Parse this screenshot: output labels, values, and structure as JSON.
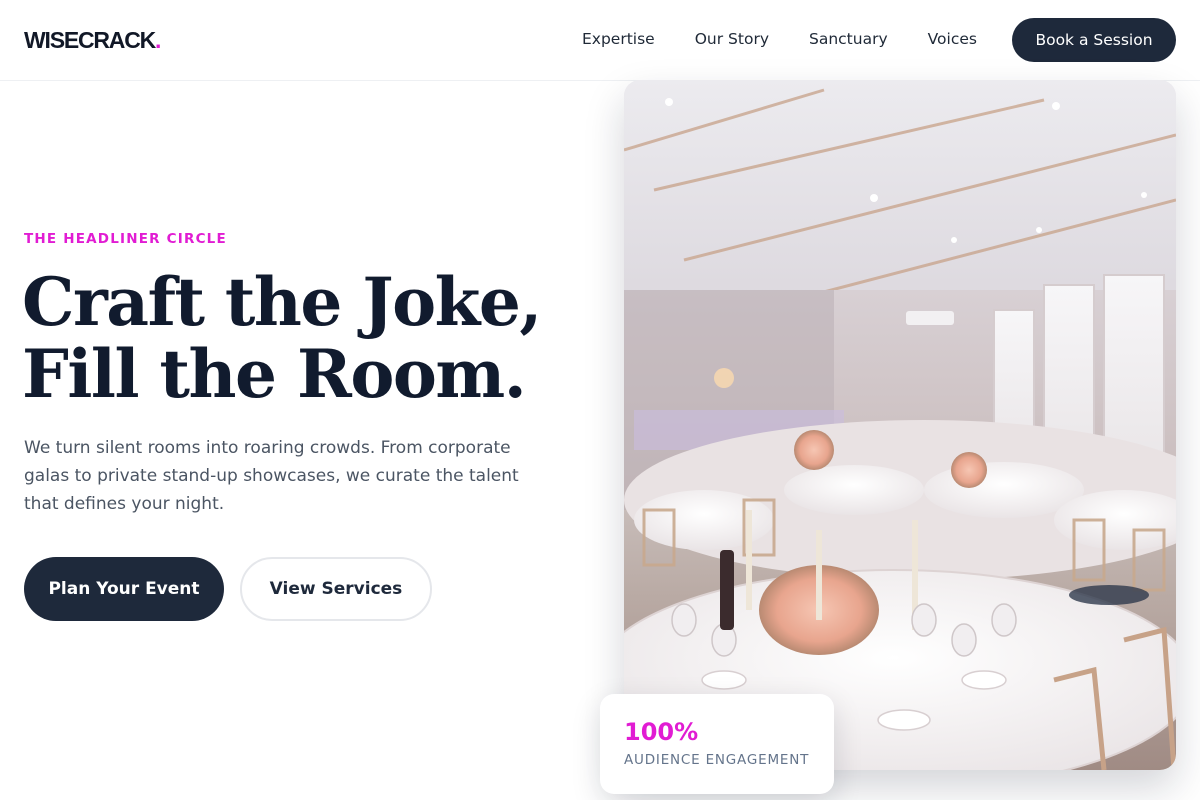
{
  "brand": {
    "name": "WISECRACK",
    "dot": ".",
    "accent_color": "#e11cd3",
    "dark_color": "#1e293b"
  },
  "nav": {
    "items": [
      {
        "label": "Expertise"
      },
      {
        "label": "Our Story"
      },
      {
        "label": "Sanctuary"
      },
      {
        "label": "Voices"
      }
    ],
    "cta_label": "Book a Session"
  },
  "hero": {
    "eyebrow": "THE HEADLINER CIRCLE",
    "headline_line1": "Craft the Joke,",
    "headline_line2": "Fill the Room.",
    "lede": "We turn silent rooms into roaring crowds. From corporate galas to private stand-up showcases, we curate the talent that defines your night.",
    "primary_button": "Plan Your Event",
    "secondary_button": "View Services",
    "image_icon": "banquet-hall-photo"
  },
  "stat": {
    "value": "100%",
    "label": "AUDIENCE ENGAGEMENT"
  }
}
